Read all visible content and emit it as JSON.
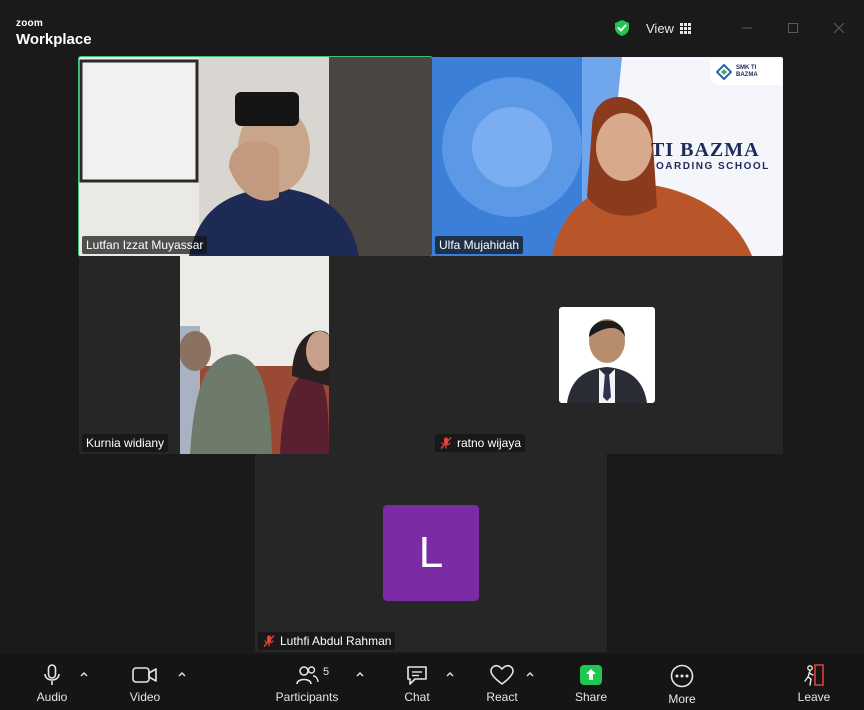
{
  "window": {
    "brand_small": "zoom",
    "brand_big": "Workplace",
    "view_label": "View"
  },
  "participants": [
    {
      "name": "Lutfan Izzat Muyassar",
      "muted": false,
      "active_speaker": true
    },
    {
      "name": "Ulfa Mujahidah",
      "muted": false,
      "active_speaker": false
    },
    {
      "name": "Kurnia widiany",
      "muted": false,
      "active_speaker": false
    },
    {
      "name": "ratno wijaya",
      "muted": true,
      "active_speaker": false
    },
    {
      "name": "Luthfi Abdul Rahman",
      "muted": true,
      "active_speaker": false,
      "avatar_letter": "L"
    }
  ],
  "background_text": {
    "banner_title": "TI BAZMA",
    "banner_sub": "OARDING SCHOOL",
    "logo_text": "SMK TI BAZMA"
  },
  "toolbar": {
    "audio": "Audio",
    "video": "Video",
    "participants": "Participants",
    "participants_count": "5",
    "chat": "Chat",
    "react": "React",
    "share": "Share",
    "more": "More",
    "leave": "Leave"
  },
  "colors": {
    "active_border": "#3ec07a",
    "share_green": "#23c552",
    "avatar_purple": "#7b2ba4",
    "leave_red": "#e03c3c",
    "mute_red": "#e0443c"
  }
}
